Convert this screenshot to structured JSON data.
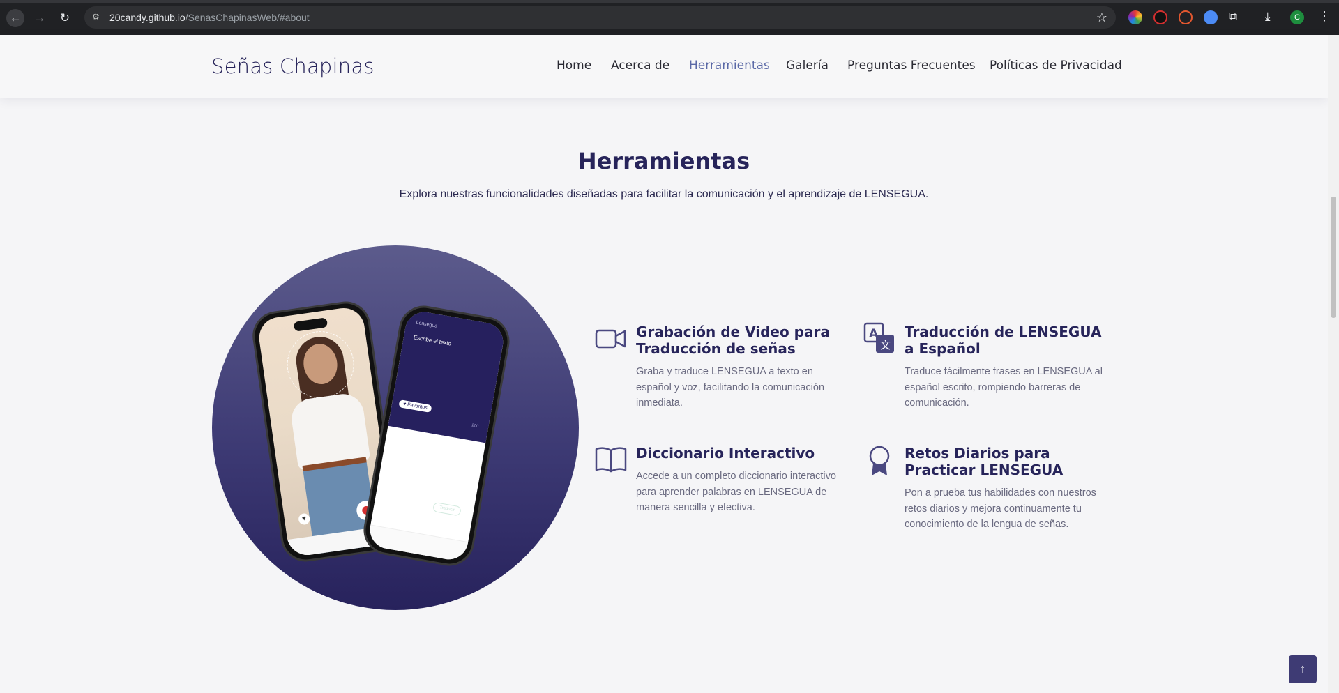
{
  "browser": {
    "url_host": "20candy.github.io",
    "url_path": "/SenasChapinasWeb/#about",
    "profile_initial": "C"
  },
  "site": {
    "brand": "Señas Chapinas",
    "nav": [
      "Home",
      "Acerca de",
      "Herramientas",
      "Galería",
      "Preguntas Frecuentes",
      "Políticas de Privacidad"
    ],
    "active_nav": "Herramientas"
  },
  "section": {
    "title": "Herramientas",
    "subtitle": "Explora nuestras funcionalidades diseñadas para facilitar la comunicación y el aprendizaje de LENSEGUA."
  },
  "phone_mock": {
    "app_name": "Lensegua",
    "input_placeholder": "Escribe el texto",
    "favorite_chip": "♥ Favoritos",
    "char_count": "200",
    "translate_button": "Traducir"
  },
  "features": [
    {
      "icon": "video-camera-icon",
      "title": "Grabación de Video para Traducción de señas",
      "description": "Graba y traduce LENSEGUA a texto en español y voz, facilitando la comunicación inmediata."
    },
    {
      "icon": "translate-icon",
      "title": "Traducción de LENSEGUA a Español",
      "description": "Traduce fácilmente frases en LENSEGUA al español escrito, rompiendo barreras de comunicación."
    },
    {
      "icon": "open-book-icon",
      "title": "Diccionario Interactivo",
      "description": "Accede a un completo diccionario interactivo para aprender palabras en LENSEGUA de manera sencilla y efectiva."
    },
    {
      "icon": "award-ribbon-icon",
      "title": "Retos Diarios para Practicar LENSEGUA",
      "description": "Pon a prueba tus habilidades con nuestros retos diarios y mejora continuamente tu conocimiento de la lengua de señas."
    }
  ],
  "colors": {
    "brand": "#27245a",
    "active_nav": "#5a68a6",
    "accent_button": "#3e3b74"
  }
}
